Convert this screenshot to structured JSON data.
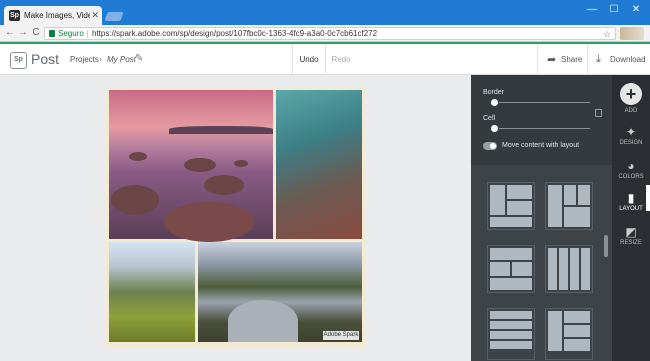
{
  "browser": {
    "tab_title": "Make Images, Videos and",
    "tab_close": "✕",
    "secure_label": "Seguro",
    "url": "https://spark.adobe.com/sp/design/post/107fbc0c-1363-4fc9-a3a0-0c7cb61cf272",
    "window_buttons": {
      "minimize": "—",
      "maximize": "☐",
      "close": "✕"
    },
    "nav": {
      "back": "←",
      "forward": "→",
      "reload": "C"
    },
    "star": "☆"
  },
  "app": {
    "logo_mark": "Sp",
    "logo_text": "Post",
    "breadcrumb": {
      "projects": "Projects",
      "separator": "›",
      "current": "My Post"
    },
    "undo": "Undo",
    "redo": "Redo",
    "share": "Share",
    "download": "Download"
  },
  "collage": {
    "watermark": "Adobe Spark"
  },
  "panel": {
    "border_label": "Border",
    "cell_label": "Cell",
    "move_content_label": "Move content with layout"
  },
  "rail": {
    "items": [
      {
        "label": "ADD",
        "icon": "plus-icon"
      },
      {
        "label": "DESIGN",
        "icon": "magic-wand-icon"
      },
      {
        "label": "COLORS",
        "icon": "palette-icon"
      },
      {
        "label": "LAYOUT",
        "icon": "layout-icon"
      },
      {
        "label": "RESIZE",
        "icon": "resize-icon"
      }
    ]
  },
  "colors": {
    "browser_blue": "#1f7bd4",
    "panel_bg": "#3e4347",
    "rail_bg": "#2b2f33",
    "secure_green": "#0b8043"
  }
}
